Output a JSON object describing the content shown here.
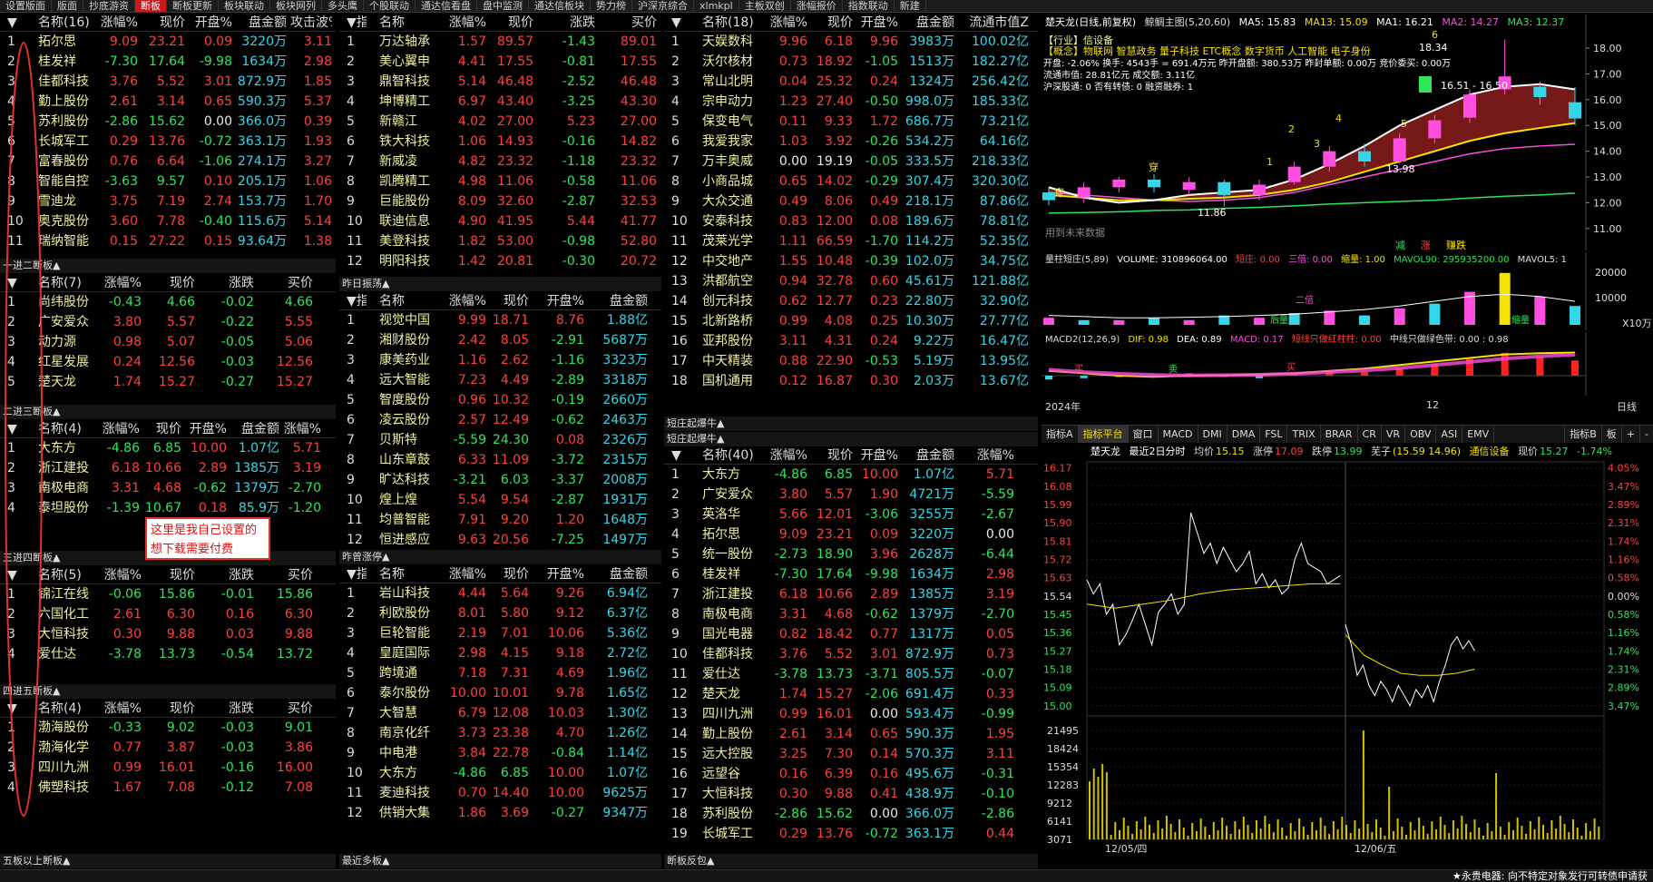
{
  "tabs": [
    "设置版面",
    "版面",
    "抄底游资",
    "断板",
    "断板更新",
    "板块联动",
    "板块网列",
    "多头鹰",
    "个股联动",
    "通达信看盘",
    "盘中监测",
    "通达信板块",
    "势力榜",
    "沪深京综合",
    "xlmkpl",
    "主板双创",
    "涨幅报价",
    "指数联动",
    "新建"
  ],
  "active_tab": 3,
  "annotation": "这里是我自己设置的想下载需要付费",
  "panels": [
    {
      "id": "p-lianban",
      "title": "",
      "footer": "一进二断板▲",
      "header": [
        "▼",
        "名称(16)",
        "涨幅%",
        "现价",
        "开盘%",
        "盘金额",
        "攻击波%"
      ],
      "rows": [
        [
          "1",
          "拓尔思",
          "9.09",
          "23.21",
          "0.09",
          "3220万",
          "3.11"
        ],
        [
          "2",
          "桂发祥",
          "-7.30",
          "17.64",
          "-9.98",
          "1634万",
          "2.98"
        ],
        [
          "3",
          "佳都科技",
          "3.76",
          "5.52",
          "3.01",
          "872.9万",
          "1.85"
        ],
        [
          "4",
          "勤上股份",
          "2.61",
          "3.14",
          "0.65",
          "590.3万",
          "5.37"
        ],
        [
          "5",
          "苏利股份",
          "-2.86",
          "15.62",
          "0.00",
          "366.0万",
          "0.39"
        ],
        [
          "6",
          "长城军工",
          "0.29",
          "13.76",
          "-0.72",
          "363.1万",
          "1.93"
        ],
        [
          "7",
          "富春股份",
          "0.76",
          "6.64",
          "-1.06",
          "274.1万",
          "3.27"
        ],
        [
          "8",
          "智能自控",
          "-3.63",
          "9.57",
          "0.10",
          "205.1万",
          "1.06"
        ],
        [
          "9",
          "雪迪龙",
          "3.75",
          "7.19",
          "2.74",
          "153.7万",
          "1.70"
        ],
        [
          "10",
          "奥克股份",
          "3.60",
          "7.78",
          "-0.40",
          "115.6万",
          "5.14"
        ],
        [
          "11",
          "瑞纳智能",
          "0.15",
          "27.22",
          "0.15",
          "93.64万",
          "1.38"
        ]
      ]
    },
    {
      "id": "p-1to2",
      "title": "",
      "footer": "二进三断板▲",
      "header": [
        "▼",
        "名称(7)",
        "涨幅%",
        "现价",
        "涨跌",
        "买价"
      ],
      "rows": [
        [
          "1",
          "尚纬股份",
          "-0.43",
          "4.66",
          "-0.02",
          "4.66"
        ],
        [
          "2",
          "广安爱众",
          "3.80",
          "5.57",
          "-0.22",
          "5.55"
        ],
        [
          "3",
          "动力源",
          "0.98",
          "5.07",
          "-0.05",
          "5.06"
        ],
        [
          "4",
          "红星发展",
          "0.24",
          "12.56",
          "-0.03",
          "12.56"
        ],
        [
          "5",
          "楚天龙",
          "1.74",
          "15.27",
          "-0.27",
          "15.27"
        ]
      ]
    },
    {
      "id": "p-2to3",
      "title": "",
      "footer": "三进四断板▲",
      "header": [
        "▼",
        "名称(4)",
        "涨幅%",
        "现价",
        "开盘%",
        "盘金额",
        "涨幅%"
      ],
      "rows": [
        [
          "1",
          "大东方",
          "-4.86",
          "6.85",
          "10.00",
          "1.07亿",
          "5.71"
        ],
        [
          "2",
          "浙江建投",
          "6.18",
          "10.66",
          "2.89",
          "1385万",
          "3.19"
        ],
        [
          "3",
          "南极电商",
          "3.31",
          "4.68",
          "-0.62",
          "1379万",
          "-2.70"
        ],
        [
          "4",
          "泰坦股份",
          "-1.39",
          "10.67",
          "0.18",
          "85.9万",
          "-1.20"
        ]
      ]
    },
    {
      "id": "p-3to4",
      "title": "",
      "footer": "四进五断板▲",
      "header": [
        "▼",
        "名称(5)",
        "涨幅%",
        "现价",
        "涨跌",
        "买价"
      ],
      "rows": [
        [
          "1",
          "锦江在线",
          "-0.06",
          "15.86",
          "-0.01",
          "15.86"
        ],
        [
          "2",
          "六国化工",
          "2.61",
          "6.30",
          "0.16",
          "6.30"
        ],
        [
          "3",
          "大恒科技",
          "0.30",
          "9.88",
          "0.03",
          "9.88"
        ],
        [
          "4",
          "爱仕达",
          "-3.78",
          "13.73",
          "-0.54",
          "13.72"
        ]
      ]
    },
    {
      "id": "p-4to5",
      "title": "",
      "footer": "五板以上断板▲",
      "header": [
        "▼",
        "名称(4)",
        "涨幅%",
        "现价",
        "涨跌",
        "买价"
      ],
      "rows": [
        [
          "1",
          "渤海股份",
          "-0.33",
          "9.02",
          "-0.03",
          "9.01"
        ],
        [
          "2",
          "渤海化学",
          "0.77",
          "3.87",
          "-0.03",
          "3.86"
        ],
        [
          "3",
          "四川九洲",
          "0.99",
          "16.01",
          "-0.16",
          "16.00"
        ],
        [
          "4",
          "佛塑科技",
          "1.67",
          "7.08",
          "-0.12",
          "7.08"
        ]
      ]
    },
    {
      "id": "p-zhishu",
      "title": "",
      "footer": "昨日振荡▲",
      "header": [
        "▼指",
        "名称",
        "涨幅%",
        "现价",
        "涨跌",
        "买价"
      ],
      "rows": [
        [
          "1",
          "万达轴承",
          "1.57",
          "89.57",
          "-1.43",
          "89.01"
        ],
        [
          "2",
          "美心翼申",
          "4.41",
          "17.55",
          "-0.81",
          "17.55"
        ],
        [
          "3",
          "鼎智科技",
          "5.14",
          "46.48",
          "-2.52",
          "46.48"
        ],
        [
          "4",
          "坤博精工",
          "6.97",
          "43.40",
          "-3.25",
          "43.30"
        ],
        [
          "5",
          "新赣江",
          "4.02",
          "27.00",
          "5.23",
          "27.00"
        ],
        [
          "6",
          "铁大科技",
          "1.06",
          "14.93",
          "-0.16",
          "14.82"
        ],
        [
          "7",
          "新威凌",
          "4.82",
          "23.32",
          "-1.18",
          "23.32"
        ],
        [
          "8",
          "凯腾精工",
          "4.98",
          "11.06",
          "-0.58",
          "11.06"
        ],
        [
          "9",
          "巨能股份",
          "8.09",
          "32.60",
          "-2.87",
          "32.53"
        ],
        [
          "10",
          "联迪信息",
          "4.90",
          "41.95",
          "5.44",
          "41.77"
        ],
        [
          "11",
          "美登科技",
          "1.82",
          "53.00",
          "-0.98",
          "52.80"
        ],
        [
          "12",
          "明阳科技",
          "1.42",
          "20.81",
          "-0.30",
          "20.72"
        ]
      ]
    },
    {
      "id": "p-zuori",
      "title": "",
      "footer": "昨曾涨停▲",
      "header": [
        "▼指",
        "名称",
        "涨幅%",
        "现价",
        "开盘%",
        "盘金额"
      ],
      "rows": [
        [
          "1",
          "视觉中国",
          "9.99",
          "18.71",
          "8.76",
          "1.88亿"
        ],
        [
          "2",
          "湘财股份",
          "2.42",
          "8.05",
          "-2.91",
          "5687万"
        ],
        [
          "3",
          "康美药业",
          "1.16",
          "2.62",
          "-1.16",
          "3323万"
        ],
        [
          "4",
          "远大智能",
          "7.23",
          "4.49",
          "-2.89",
          "3318万"
        ],
        [
          "5",
          "智度股份",
          "0.96",
          "10.32",
          "-0.19",
          "2660万"
        ],
        [
          "6",
          "凌云股份",
          "2.57",
          "12.49",
          "-0.62",
          "2463万"
        ],
        [
          "7",
          "贝斯特",
          "-5.59",
          "24.30",
          "0.08",
          "2326万"
        ],
        [
          "8",
          "山东章鼓",
          "6.33",
          "11.09",
          "-3.72",
          "2315万"
        ],
        [
          "9",
          "旷达科技",
          "-3.21",
          "6.03",
          "-3.37",
          "2008万"
        ],
        [
          "10",
          "煌上煌",
          "5.54",
          "9.54",
          "-2.87",
          "1931万"
        ],
        [
          "11",
          "均普智能",
          "7.91",
          "9.20",
          "1.20",
          "1648万"
        ],
        [
          "12",
          "恒进感应",
          "9.63",
          "20.56",
          "-7.25",
          "1497万"
        ]
      ]
    },
    {
      "id": "p-zuoceng",
      "title": "",
      "footer": "最近多板▲",
      "header": [
        "▼指",
        "名称",
        "涨幅%",
        "现价",
        "开盘%",
        "盘金额"
      ],
      "rows": [
        [
          "1",
          "岩山科技",
          "4.44",
          "5.64",
          "9.26",
          "6.94亿"
        ],
        [
          "2",
          "利欧股份",
          "8.01",
          "5.80",
          "9.12",
          "6.37亿"
        ],
        [
          "3",
          "巨轮智能",
          "2.19",
          "7.01",
          "10.06",
          "5.36亿"
        ],
        [
          "4",
          "皇庭国际",
          "2.98",
          "4.15",
          "9.18",
          "2.72亿"
        ],
        [
          "5",
          "跨境通",
          "7.18",
          "7.31",
          "4.69",
          "1.96亿"
        ],
        [
          "6",
          "泰尔股份",
          "10.00",
          "10.01",
          "9.78",
          "1.65亿"
        ],
        [
          "7",
          "大智慧",
          "6.79",
          "12.08",
          "10.03",
          "1.30亿"
        ],
        [
          "8",
          "南京化纤",
          "3.73",
          "23.38",
          "4.70",
          "1.26亿"
        ],
        [
          "9",
          "中电港",
          "3.84",
          "22.78",
          "-0.84",
          "1.14亿"
        ],
        [
          "10",
          "大东方",
          "-4.86",
          "6.85",
          "10.00",
          "1.07亿"
        ],
        [
          "11",
          "麦迪科技",
          "0.70",
          "14.40",
          "10.00",
          "9625万"
        ],
        [
          "12",
          "供销大集",
          "1.86",
          "3.69",
          "-0.27",
          "9347万"
        ]
      ]
    },
    {
      "id": "p-right",
      "title": "",
      "footer": "短庄起爆牛▲",
      "header": [
        "▼",
        "名称(18)",
        "涨幅%",
        "现价",
        "开盘%",
        "盘金额",
        "流通市值Z"
      ],
      "rows": [
        [
          "1",
          "天娱数科",
          "9.96",
          "6.18",
          "9.96",
          "3983万",
          "100.02亿"
        ],
        [
          "2",
          "沃尔核材",
          "0.73",
          "18.92",
          "-1.05",
          "1513万",
          "182.27亿"
        ],
        [
          "3",
          "常山北明",
          "0.04",
          "25.32",
          "0.24",
          "1324万",
          "256.42亿"
        ],
        [
          "4",
          "宗申动力",
          "1.23",
          "27.40",
          "-0.50",
          "998.0万",
          "185.33亿"
        ],
        [
          "5",
          "保变电气",
          "0.11",
          "9.33",
          "1.72",
          "686.7万",
          "73.21亿"
        ],
        [
          "6",
          "我爱我家",
          "1.03",
          "3.92",
          "-0.26",
          "534.2万",
          "64.16亿"
        ],
        [
          "7",
          "万丰奥威",
          "0.00",
          "19.19",
          "-0.05",
          "333.5万",
          "218.33亿"
        ],
        [
          "8",
          "小商品城",
          "0.65",
          "14.02",
          "-0.29",
          "307.4万",
          "320.30亿"
        ],
        [
          "9",
          "大众交通",
          "0.49",
          "8.06",
          "0.49",
          "218.1万",
          "87.86亿"
        ],
        [
          "10",
          "安泰科技",
          "0.83",
          "12.00",
          "0.08",
          "189.6万",
          "78.81亿"
        ],
        [
          "11",
          "茂莱光学",
          "1.11",
          "66.59",
          "-1.70",
          "114.2万",
          "52.35亿"
        ],
        [
          "12",
          "中交地产",
          "1.55",
          "10.48",
          "-0.39",
          "102.0万",
          "34.75亿"
        ],
        [
          "13",
          "洪都航空",
          "0.94",
          "32.78",
          "0.60",
          "45.61万",
          "121.88亿"
        ],
        [
          "14",
          "创元科技",
          "0.62",
          "12.77",
          "0.23",
          "22.80万",
          "32.90亿"
        ],
        [
          "15",
          "北新路桥",
          "0.99",
          "4.08",
          "0.25",
          "10.30万",
          "27.77亿"
        ],
        [
          "16",
          "亚邦股份",
          "3.11",
          "4.31",
          "0.24",
          "9.22万",
          "16.47亿"
        ],
        [
          "17",
          "中天精装",
          "0.88",
          "22.90",
          "-0.53",
          "5.19万",
          "13.95亿"
        ],
        [
          "18",
          "国机通用",
          "0.12",
          "16.87",
          "0.30",
          "2.03万",
          "13.67亿"
        ]
      ]
    },
    {
      "id": "p-duanzhuang",
      "title": "短庄起爆牛▲",
      "footer": "断板反包▲",
      "header": [
        "▼",
        "名称(40)",
        "涨幅%",
        "现价",
        "开盘%",
        "盘金额",
        "涨幅%"
      ],
      "rows": [
        [
          "1",
          "大东方",
          "-4.86",
          "6.85",
          "10.00",
          "1.07亿",
          "5.71"
        ],
        [
          "2",
          "广安爱众",
          "3.80",
          "5.57",
          "1.90",
          "4721万",
          "-5.59"
        ],
        [
          "3",
          "英洛华",
          "5.66",
          "12.01",
          "-3.06",
          "3255万",
          "-2.67"
        ],
        [
          "4",
          "拓尔思",
          "9.09",
          "23.21",
          "0.09",
          "3220万",
          "0.00"
        ],
        [
          "5",
          "统一股份",
          "-2.73",
          "18.90",
          "3.96",
          "2628万",
          "-6.44"
        ],
        [
          "6",
          "桂发祥",
          "-7.30",
          "17.64",
          "-9.98",
          "1634万",
          "2.98"
        ],
        [
          "7",
          "浙江建投",
          "6.18",
          "10.66",
          "2.89",
          "1385万",
          "3.19"
        ],
        [
          "8",
          "南极电商",
          "3.31",
          "4.68",
          "-0.62",
          "1379万",
          "-2.70"
        ],
        [
          "9",
          "国光电器",
          "0.82",
          "18.42",
          "0.77",
          "1317万",
          "0.05"
        ],
        [
          "10",
          "佳都科技",
          "3.76",
          "5.52",
          "3.01",
          "872.9万",
          "0.73"
        ],
        [
          "11",
          "爱仕达",
          "-3.78",
          "13.73",
          "-3.71",
          "805.5万",
          "-0.07"
        ],
        [
          "12",
          "楚天龙",
          "1.74",
          "15.27",
          "-2.06",
          "691.4万",
          "0.33"
        ],
        [
          "13",
          "四川九洲",
          "0.99",
          "16.01",
          "0.00",
          "593.4万",
          "-0.99"
        ],
        [
          "14",
          "勤上股份",
          "2.61",
          "3.14",
          "0.65",
          "590.3万",
          "1.95"
        ],
        [
          "15",
          "远大控股",
          "3.25",
          "7.30",
          "0.14",
          "570.3万",
          "3.11"
        ],
        [
          "16",
          "远望谷",
          "0.16",
          "6.39",
          "0.16",
          "495.6万",
          "-0.31"
        ],
        [
          "17",
          "大恒科技",
          "0.30",
          "9.88",
          "0.41",
          "438.9万",
          "-0.10"
        ],
        [
          "18",
          "苏利股份",
          "-2.86",
          "15.62",
          "0.00",
          "366.0万",
          "-2.86"
        ],
        [
          "19",
          "长城军工",
          "0.29",
          "13.76",
          "-0.72",
          "363.1万",
          "0.44"
        ]
      ]
    }
  ],
  "kline": {
    "title": "楚天龙(日线,前复权)",
    "indicator": "鲸鲷主图(5,20,60)",
    "ma5": "MA5: 15.83",
    "ma13": "MA13: 15.09",
    "ma1": "MA1: 16.21",
    "ma2": "MA2: 14.27",
    "ma3": "MA3: 12.37",
    "info1": "【行业】信设备",
    "info2": "【概念】物联网 智慧政务 量子科技 ETC概念 数字货币 人工智能 电子身份",
    "info3": "开盘: -2.06%  换手: 4543手 = 691.4万元  昨开盘额: 380.53万  昨封单额: 0.00万  竞价委买: 0.00万",
    "info4": "流通市值: 28.81亿元  成交额: 3.11亿",
    "info5": "沪深股通: 0  否有转债: 0  融资融券: 1",
    "range_label": "16.51 - 16.50",
    "low_label": "11.86",
    "low2_label": "13.98",
    "hi_label": "18.34",
    "yticks": [
      "18.00",
      "17.00",
      "16.00",
      "15.00",
      "14.00",
      "13.00",
      "12.00",
      "11.00"
    ],
    "ylim": [
      10.5,
      18.6
    ],
    "bottom_note": "用到未来数据",
    "legend": [
      "减",
      "涨",
      "赚跌"
    ],
    "mark_nums": [
      "1",
      "2",
      "3",
      "4",
      "5",
      "6"
    ],
    "mark_chars": [
      "穿",
      "穿"
    ]
  },
  "volume": {
    "title": "量柱短庄(5,89)",
    "vol": "VOLUME: 310896064.00",
    "t1": "短庄: 0.00",
    "t2": "三倍: 0.00",
    "t3": "缩量: 1.00",
    "t4": "MAVOL90: 295935200.00",
    "t5": "MAVOL5: 1",
    "yticks": [
      "20000",
      "10000"
    ],
    "unit": "X10万",
    "mk": [
      "后量",
      "二倍",
      "缩量"
    ]
  },
  "macd": {
    "title": "MACD2(12,26,9)",
    "dif": "DIF: 0.98",
    "dea": "DEA: 0.89",
    "macd": "MACD: 0.17",
    "t1": "短线只做红柱柱: 0.00",
    "t2": "中线只做绿色带: 0.00 : 0.98",
    "year": "2024年",
    "month": "12",
    "mk": [
      "买",
      "卖",
      "买"
    ]
  },
  "ind_tabs": [
    "指标A",
    "指标平台",
    "窗口",
    "MACD",
    "DMI",
    "DMA",
    "FSL",
    "TRIX",
    "BRAR",
    "CR",
    "VR",
    "OBV",
    "ASI",
    "EMV"
  ],
  "ind_tabs_right": [
    "指标B",
    "板",
    "+",
    "-"
  ],
  "timeshare": {
    "name": "楚天龙",
    "label": "最近2日分时",
    "avg": "均价",
    "avgv": "15.15",
    "zt": "涨停",
    "ztv": "17.09",
    "dt": "跌停",
    "dtv": "13.99",
    "zhi": "芜子",
    "zhiv": "(15.59 14.96)",
    "sector": "通信设备",
    "price_lbl": "现价",
    "price": "15.27",
    "pct": "-1.74%",
    "yticks": [
      "16.17",
      "16.08",
      "15.99",
      "15.90",
      "15.81",
      "15.72",
      "15.63",
      "15.54",
      "15.45",
      "15.36",
      "15.27",
      "15.18",
      "15.09",
      "15.00"
    ],
    "pticks": [
      "4.05%",
      "3.47%",
      "2.89%",
      "2.31%",
      "1.74%",
      "1.16%",
      "0.58%",
      "0.00%",
      "0.58%",
      "1.16%",
      "1.74%",
      "2.31%",
      "2.89%",
      "3.47%"
    ],
    "vticks": [
      "21495",
      "18424",
      "15354",
      "12283",
      "9212",
      "6141",
      "3071"
    ],
    "dates": [
      "12/05/四",
      "12/06/五"
    ]
  },
  "statusbar": "★永贵电器: 向不特定对象发行可转债申请获",
  "right_date": "日线",
  "colors": {
    "up": "#ff4040",
    "down": "#2ee65c",
    "accent": "#c8171e",
    "annotation": "#e53030"
  }
}
